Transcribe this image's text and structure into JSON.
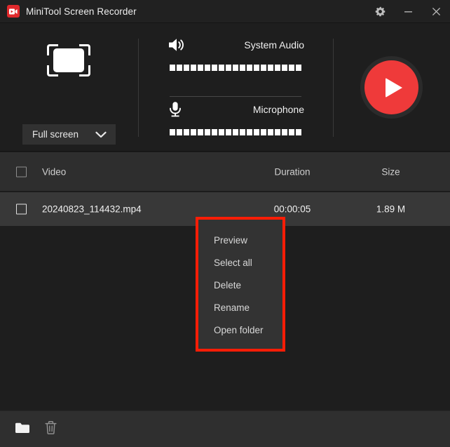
{
  "window": {
    "title": "MiniTool Screen Recorder",
    "app_icon": "video-camera-icon",
    "controls": {
      "settings": "gear-icon",
      "minimize": "minimize-icon",
      "close": "close-icon"
    }
  },
  "capture": {
    "icon": "fullscreen-capture-icon",
    "mode_label": "Full screen",
    "chevron": "chevron-down-icon"
  },
  "audio": {
    "system": {
      "icon": "speaker-icon",
      "label": "System Audio",
      "meter_segments": 19,
      "meter_level": 0
    },
    "microphone": {
      "icon": "microphone-icon",
      "label": "Microphone",
      "meter_segments": 19,
      "meter_level": 0
    }
  },
  "record": {
    "button_label": "record-button",
    "icon": "play-triangle-icon",
    "color": "#ef3a3a"
  },
  "table": {
    "headers": {
      "select_all": "select-all-checkbox",
      "video": "Video",
      "duration": "Duration",
      "size": "Size"
    },
    "rows": [
      {
        "checked": false,
        "video": "20240823_114432.mp4",
        "duration": "00:00:05",
        "size": "1.89 M"
      }
    ]
  },
  "context_menu": {
    "highlight_color": "#fe1d06",
    "items": [
      {
        "label": "Preview"
      },
      {
        "label": "Select all"
      },
      {
        "label": "Delete"
      },
      {
        "label": "Rename"
      },
      {
        "label": "Open folder"
      }
    ]
  },
  "bottom_bar": {
    "open_folder": "folder-icon",
    "delete": "trash-icon"
  }
}
